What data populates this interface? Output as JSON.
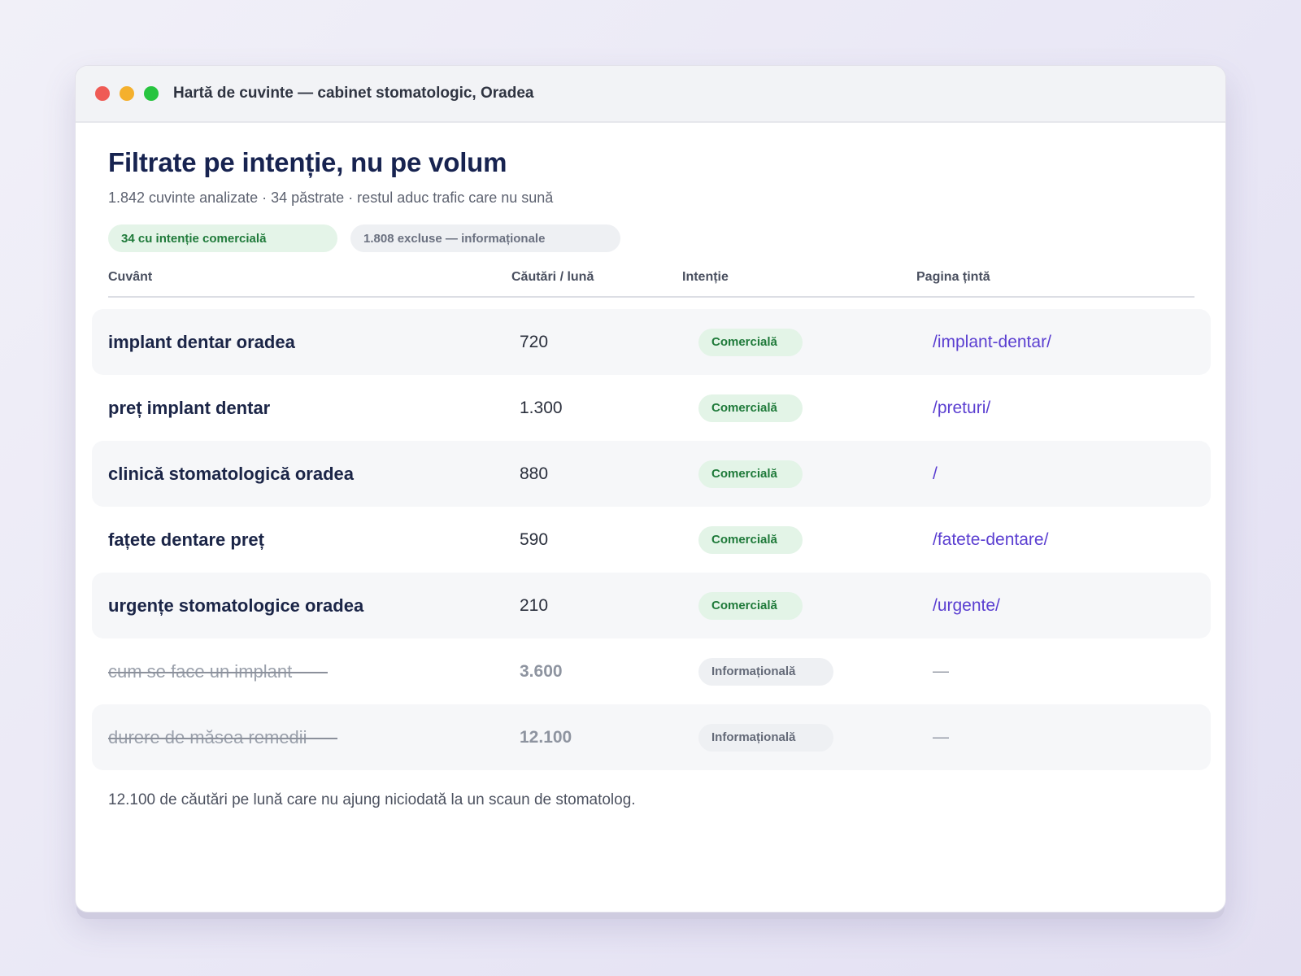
{
  "window": {
    "title": "Hartă de cuvinte — cabinet stomatologic, Oradea"
  },
  "header": {
    "headline": "Filtrate pe intenție, nu pe volum",
    "subline": "1.842 cuvinte analizate · 34 păstrate · restul aduc trafic care nu sună"
  },
  "filters": {
    "kept": "34 cu intenție comercială",
    "excluded": "1.808 excluse — informaționale"
  },
  "table": {
    "columns": [
      "Cuvânt",
      "Căutări / lună",
      "Intenție",
      "Pagina țintă"
    ],
    "rows": [
      {
        "keyword": "implant dentar oradea",
        "volume": "720",
        "intent": "Comercială",
        "page": "/implant-dentar/"
      },
      {
        "keyword": "preț implant dentar",
        "volume": "1.300",
        "intent": "Comercială",
        "page": "/preturi/"
      },
      {
        "keyword": "clinică stomatologică oradea",
        "volume": "880",
        "intent": "Comercială",
        "page": "/"
      },
      {
        "keyword": "fațete dentare preț",
        "volume": "590",
        "intent": "Comercială",
        "page": "/fatete-dentare/"
      },
      {
        "keyword": "urgențe stomatologice oradea",
        "volume": "210",
        "intent": "Comercială",
        "page": "/urgente/"
      },
      {
        "keyword": "cum se face un implant",
        "volume": "3.600",
        "intent": "Informațională",
        "page": "—"
      },
      {
        "keyword": "durere de măsea remedii",
        "volume": "12.100",
        "intent": "Informațională",
        "page": "—"
      }
    ]
  },
  "footnote": "12.100 de căutări pe lună care nu ajung niciodată la un scaun de stomatolog.",
  "colors": {
    "accent_link": "#5b3fd1",
    "commercial_green": "#1f7a3a",
    "headline_navy": "#172350"
  }
}
